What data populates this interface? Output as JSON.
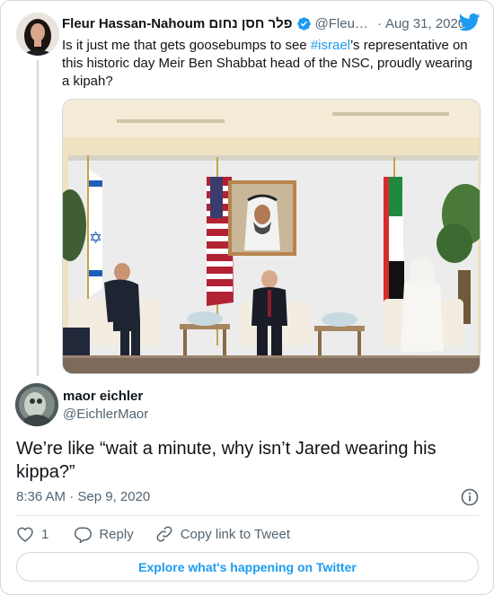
{
  "quoted_tweet": {
    "author_name": "Fleur Hassan-Nahoum פלר חסן נחום",
    "handle": "@Fleu…",
    "separator": "·",
    "date": "Aug 31, 2020",
    "text_before": "Is it just me that gets goosebumps to see ",
    "hashtag": "#israel",
    "text_after": "’s representative on this historic day Meir Ben Shabbat head of the NSC, proudly wearing a kipah?",
    "verified_icon": "verified-badge-icon",
    "logo_icon": "twitter-bird-icon"
  },
  "main_tweet": {
    "author_name": "maor eichler",
    "handle": "@EichlerMaor",
    "text": "We’re like “wait a minute, why isn’t Jared wearing his kippa?”",
    "timestamp": "8:36 AM · Sep 9, 2020",
    "info_icon": "info-icon"
  },
  "actions": {
    "like_icon": "heart-icon",
    "like_count": "1",
    "reply_icon": "reply-icon",
    "reply_label": "Reply",
    "copy_icon": "link-icon",
    "copy_label": "Copy link to Tweet"
  },
  "explore_label": "Explore what's happening on Twitter",
  "colors": {
    "accent": "#1d9bf0",
    "text": "#0f1419",
    "secondary": "#536471",
    "border": "#cfd9de"
  }
}
